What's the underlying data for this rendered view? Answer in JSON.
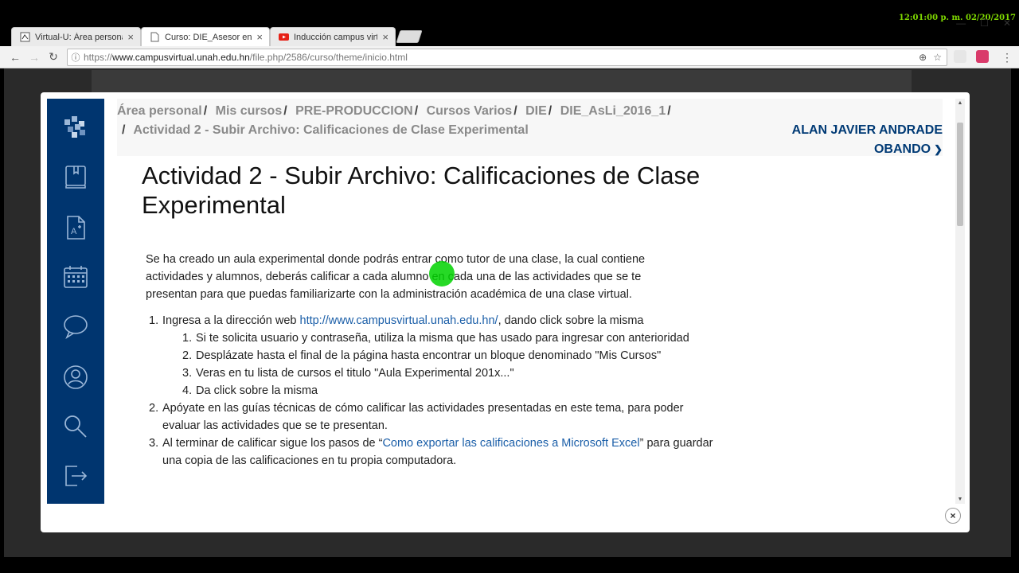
{
  "clock": "12:01:00 p. m. 02/20/2017",
  "tabs": [
    {
      "label": "Virtual-U: Área personal",
      "active": false
    },
    {
      "label": "Curso: DIE_Asesor en Lin",
      "active": true
    },
    {
      "label": "Inducción campus virtual",
      "active": false
    }
  ],
  "address": {
    "scheme": "https://",
    "host": "www.campusvirtual.unah.edu.hn",
    "path": "/file.php/2586/curso/theme/inicio.html"
  },
  "breadcrumb": {
    "items": [
      "Área personal",
      "Mis cursos",
      "PRE-PRODUCCION",
      "Cursos Varios",
      "DIE",
      "DIE_AsLi_2016_1"
    ],
    "current": "Actividad 2 - Subir Archivo: Calificaciones de Clase Experimental",
    "separator": "/"
  },
  "user": {
    "line1": "ALAN JAVIER ANDRADE",
    "line2": "OBANDO"
  },
  "page": {
    "title": "Actividad 2 - Subir Archivo: Calificaciones de Clase Experimental",
    "intro": "Se ha creado un aula experimental donde podrás entrar como tutor de una clase, la cual contiene actividades y alumnos, deberás calificar a cada alumno en cada una de las actividades que se te presentan para que puedas familiarizarte con la administración académica de una clase virtual.",
    "steps": [
      {
        "num": "1.",
        "before": "Ingresa a la dirección web ",
        "link": "http://www.campusvirtual.unah.edu.hn/",
        "after": ", dando click sobre la misma",
        "substeps": [
          {
            "num": "1.",
            "text": "Si te solicita usuario y contraseña, utiliza la misma que has usado para ingresar con anterioridad"
          },
          {
            "num": "2.",
            "text": "Desplázate hasta el final de la página hasta encontrar un bloque denominado \"Mis Cursos\""
          },
          {
            "num": "3.",
            "text": "Veras en tu lista de cursos el titulo \"Aula Experimental 201x...\""
          },
          {
            "num": "4.",
            "text": "Da click sobre la misma"
          }
        ]
      },
      {
        "num": "2.",
        "text": "Apóyate en las guías técnicas de cómo calificar las actividades presentadas en este tema, para poder evaluar las actividades que se te presentan."
      },
      {
        "num": "3.",
        "before": "Al terminar de calificar sigue los pasos de “",
        "link": "Como exportar las calificaciones a Microsoft Excel",
        "after": "” para guardar una copia de las calificaciones en tu propia computadora."
      }
    ]
  },
  "sidebar_icons": [
    "logo-icon",
    "book-icon",
    "document-icon",
    "calendar-icon",
    "chat-icon",
    "profile-icon",
    "search-icon",
    "logout-icon"
  ],
  "close_label": "×",
  "colors": {
    "sidebar": "#00356f",
    "link": "#1a5ea8",
    "username": "#003a75",
    "crumb": "#8a8a8a"
  }
}
